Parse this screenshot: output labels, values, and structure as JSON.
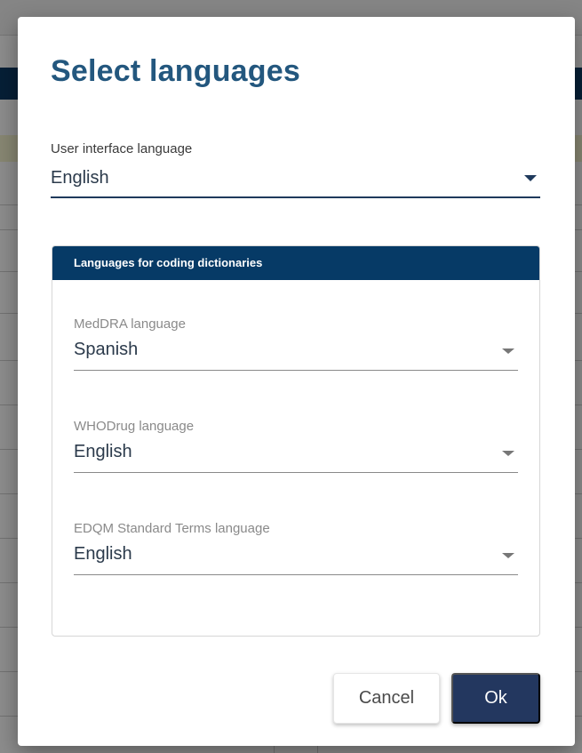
{
  "dialog": {
    "title": "Select languages",
    "ui_language": {
      "label": "User interface language",
      "value": "English"
    },
    "coding_dictionaries": {
      "header": "Languages for coding dictionaries",
      "fields": [
        {
          "label": "MedDRA language",
          "value": "Spanish"
        },
        {
          "label": "WHODrug language",
          "value": "English"
        },
        {
          "label": "EDQM Standard Terms language",
          "value": "English"
        }
      ]
    },
    "buttons": {
      "cancel": "Cancel",
      "ok": "Ok"
    }
  },
  "colors": {
    "title": "#23577e",
    "card_header": "#063a66",
    "ok_button": "#23375f"
  },
  "icons": {
    "dropdown": "caret-down-icon"
  }
}
